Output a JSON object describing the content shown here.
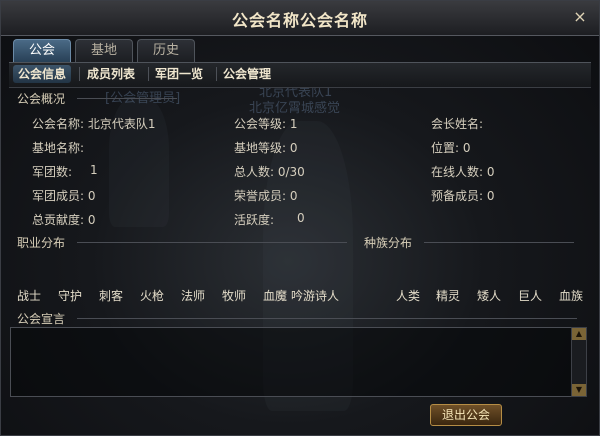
{
  "window": {
    "title": "公会名称公会名称",
    "close_symbol": "×"
  },
  "tabs": [
    {
      "label": "公会",
      "active": true
    },
    {
      "label": "基地",
      "active": false
    },
    {
      "label": "历史",
      "active": false
    }
  ],
  "subtabs": [
    {
      "label": "公会信息",
      "active": true
    },
    {
      "label": "成员列表",
      "active": false
    },
    {
      "label": "军团一览",
      "active": false
    },
    {
      "label": "公会管理",
      "active": false
    }
  ],
  "background_text": {
    "line1": "[公会管理员]",
    "line2": "北京代表队1",
    "line3": "北京亿霄城感觉"
  },
  "overview": {
    "title": "公会概况",
    "guild_name": "公会名称: 北京代表队1",
    "base_name": "基地名称:",
    "legion_count": "军团数:",
    "legion_count_value": "1",
    "legion_members": "军团成员: 0",
    "total_contribution": "总贡献度: 0",
    "guild_level": "公会等级: 1",
    "base_level": "基地等级: 0",
    "total_members": "总人数: 0/30",
    "honor_members": "荣誉成员: 0",
    "activity": "活跃度:",
    "activity_value": "0",
    "leader_name": "会长姓名:",
    "position": "位置: 0",
    "online_count": "在线人数: 0",
    "reserve_members": "预备成员: 0"
  },
  "class_distribution": {
    "title": "职业分布",
    "classes": [
      "战士",
      "守护",
      "刺客",
      "火枪",
      "法师",
      "牧师",
      "血魔",
      "吟游诗人"
    ]
  },
  "race_distribution": {
    "title": "种族分布",
    "races": [
      "人类",
      "精灵",
      "矮人",
      "巨人",
      "血族"
    ]
  },
  "declaration": {
    "title": "公会宣言",
    "text": ""
  },
  "footer": {
    "exit_label": "退出公会"
  },
  "colors": {
    "accent_gold": "#b58d45",
    "active_tab": "#4a6a86"
  }
}
